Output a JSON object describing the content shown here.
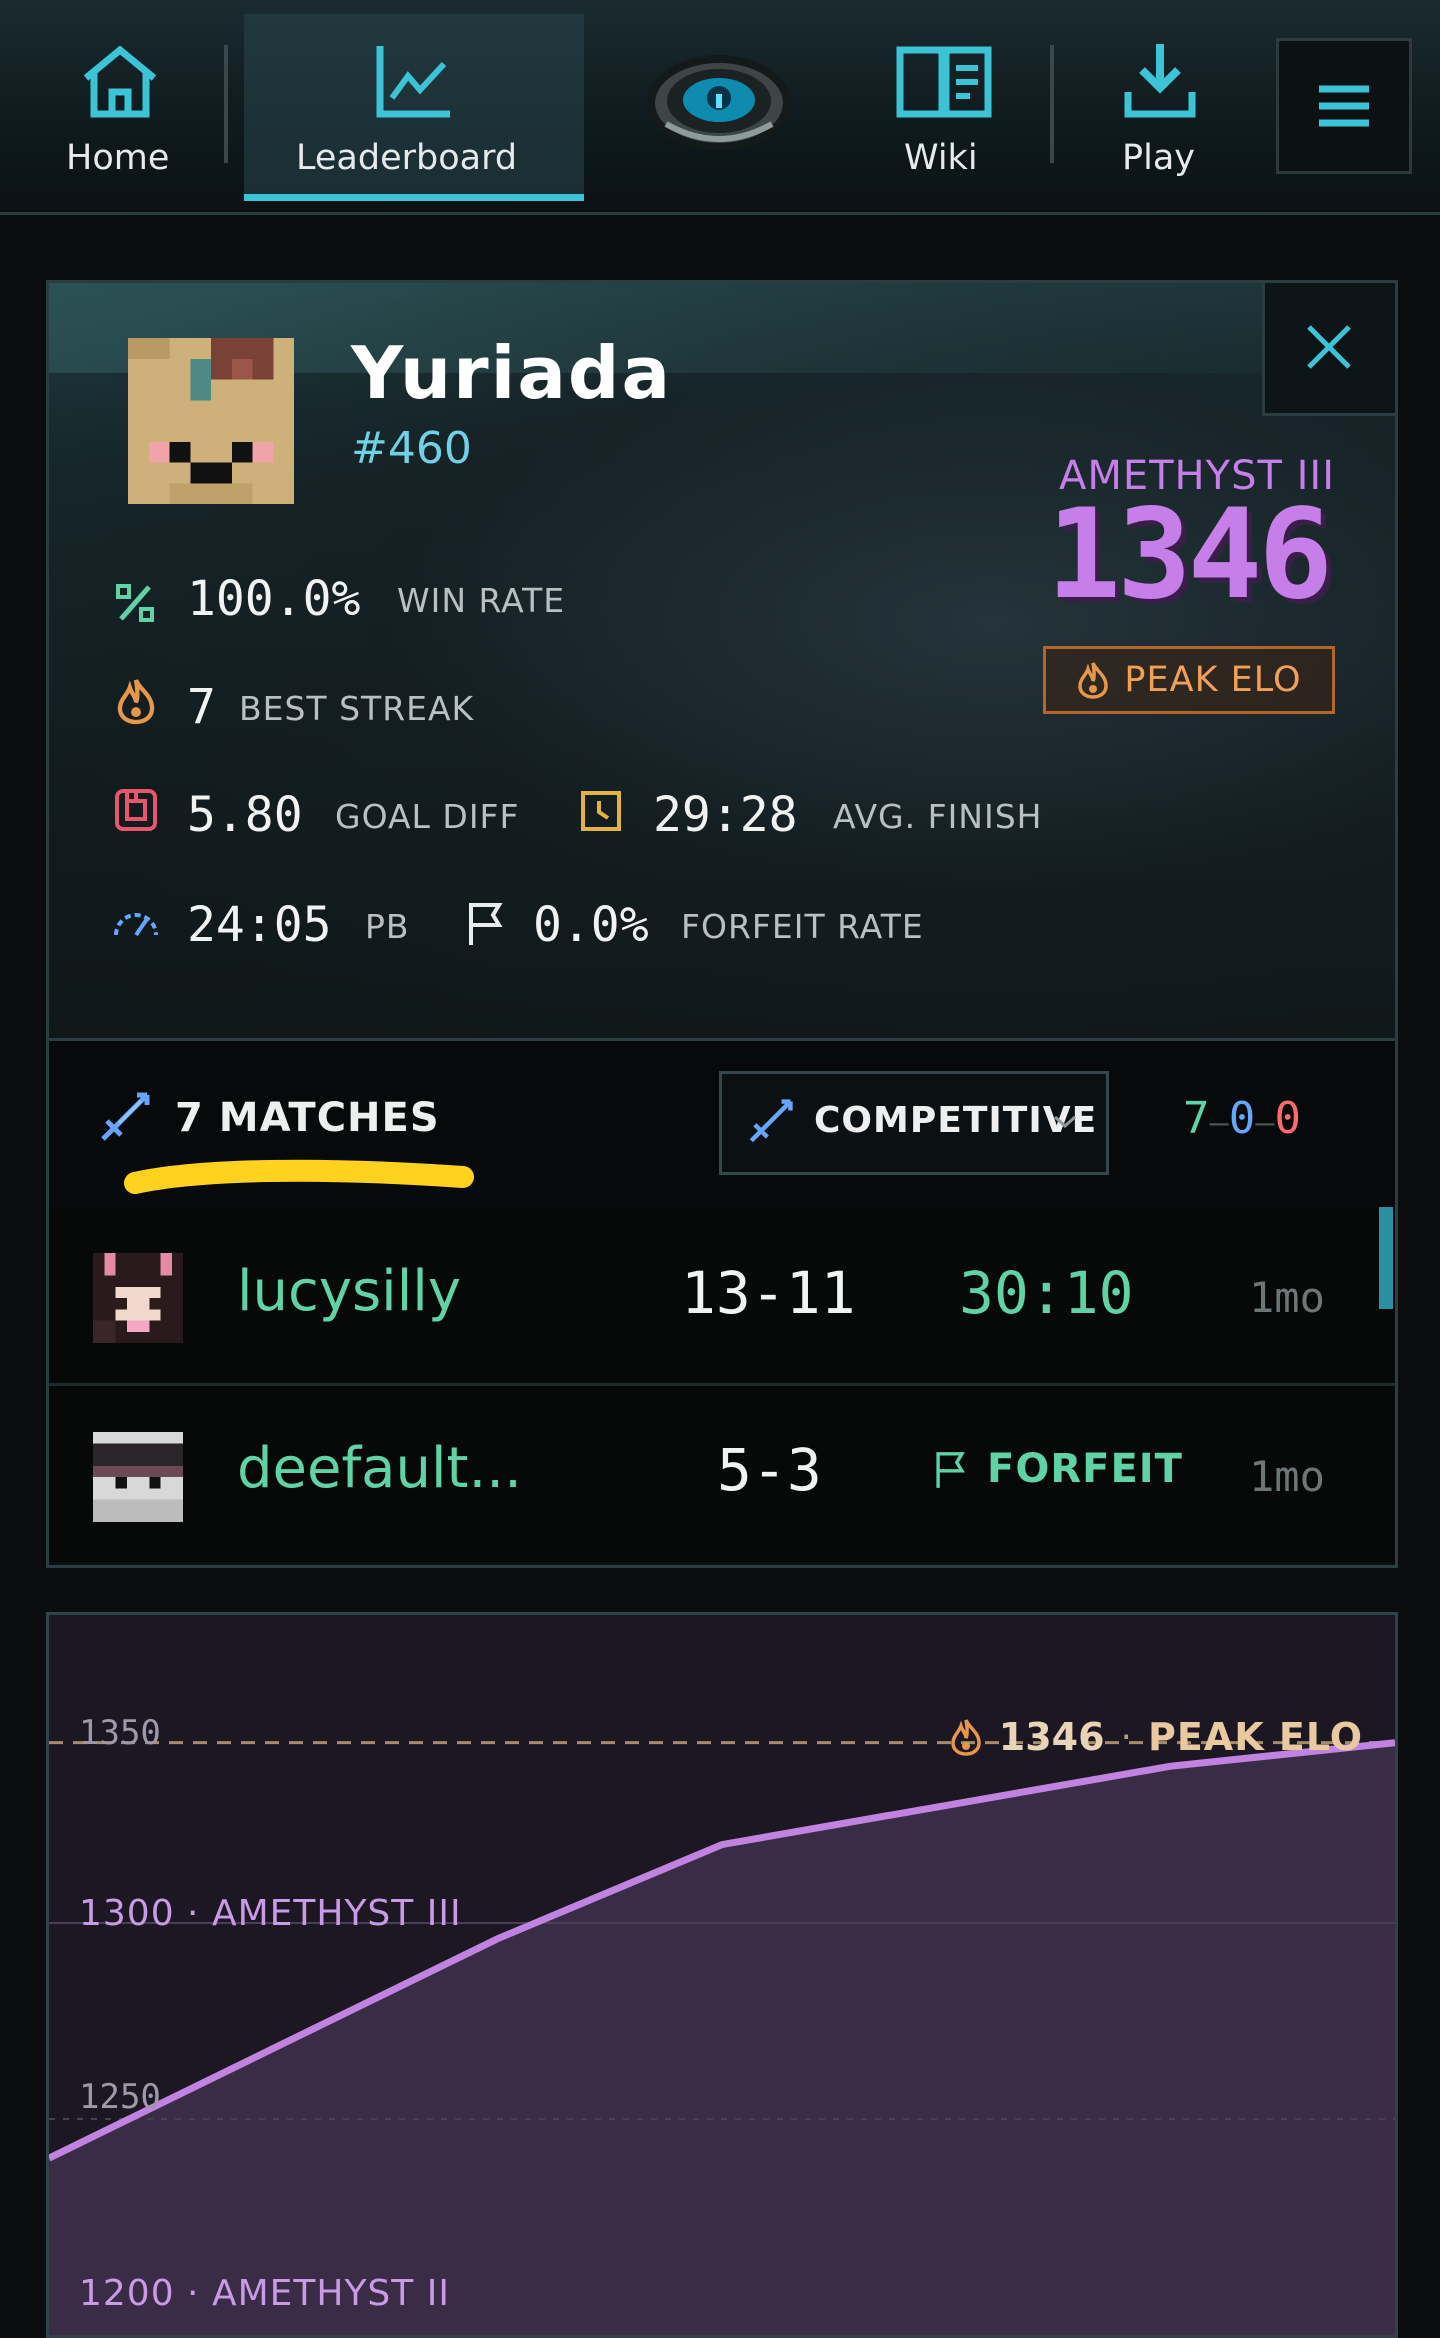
{
  "nav": {
    "items": [
      {
        "label": "Home",
        "icon": "home-icon"
      },
      {
        "label": "Leaderboard",
        "icon": "chart-icon"
      },
      {
        "label": "Wiki",
        "icon": "book-icon"
      },
      {
        "label": "Play",
        "icon": "download-icon"
      }
    ],
    "active": "Leaderboard",
    "logo_icon": "eye-logo-icon",
    "menu_icon": "hamburger-icon"
  },
  "profile": {
    "name": "Yuriada",
    "rank": "#460",
    "tier": "AMETHYST III",
    "elo": "1346",
    "peak_label": "PEAK ELO",
    "stats": {
      "win_rate": {
        "value": "100.0%",
        "label": "WIN RATE"
      },
      "best_streak": {
        "value": "7",
        "label": "BEST STREAK"
      },
      "goal_diff": {
        "value": "5.80",
        "label": "GOAL DIFF"
      },
      "avg_finish": {
        "value": "29:28",
        "label": "AVG. FINISH"
      },
      "pb": {
        "value": "24:05",
        "label": "PB"
      },
      "forfeit_rate": {
        "value": "0.0%",
        "label": "FORFEIT RATE"
      }
    }
  },
  "matches": {
    "count_label": "7 MATCHES",
    "mode": "COMPETITIVE",
    "record": {
      "wins": "7",
      "draws": "0",
      "losses": "0",
      "sep": "–"
    },
    "rows": [
      {
        "player": "lucysilly",
        "score": "13-11",
        "result": "30:10",
        "ago": "1mo"
      },
      {
        "player": "deefault...",
        "score": "5-3",
        "result": "FORFEIT",
        "ago": "1mo"
      }
    ]
  },
  "chart_data": {
    "type": "line",
    "series": [
      {
        "values": [
          1240,
          1268,
          1296,
          1320,
          1330,
          1340,
          1346
        ]
      }
    ],
    "ylim": [
      1190,
      1355
    ],
    "ticks": [
      "1350",
      "1300 · AMETHYST III",
      "1250",
      "1200 · AMETHYST II"
    ],
    "peak_annotation": {
      "value": "1346",
      "separator": "·",
      "label": "PEAK ELO"
    },
    "colors": {
      "line": "#c083e0",
      "fill": "#3a2b47",
      "peak_line": "#a38c6a"
    }
  },
  "colors": {
    "accent": "#3cc4d6",
    "green": "#5fd3a6",
    "amethyst": "#c67ee8",
    "orange": "#e6974a",
    "red": "#ff6b6b",
    "blue": "#66a6ff"
  }
}
